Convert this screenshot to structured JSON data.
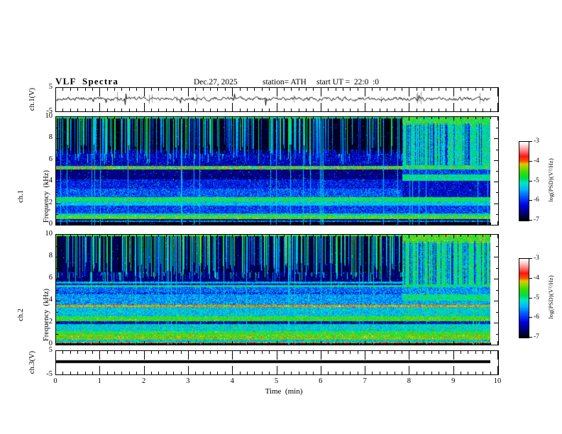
{
  "title": "VLF  Spectra",
  "header": {
    "date": "Dec.27, 2025",
    "station": "station= ATH",
    "start": "start UT =  22:0  :0"
  },
  "axes": {
    "time_label": "Time  (min)",
    "x_ticks": [
      "0",
      "1",
      "2",
      "3",
      "4",
      "5",
      "6",
      "7",
      "8",
      "9",
      "10"
    ],
    "freq_ticks": [
      "10",
      "8",
      "6",
      "4",
      "2",
      "0"
    ],
    "volt_ticks": [
      "5",
      "-5"
    ],
    "wave1_label": "ch.1(V)",
    "spec1_label": [
      "ch.1",
      "Frequency  (kHz)"
    ],
    "spec2_label": [
      "ch.2",
      "Frequency  (kHz)"
    ],
    "wave3_label": "ch.3(V)"
  },
  "colorbar": {
    "label": "log(PSD)(V²/Hz)",
    "ticks": [
      "-3",
      "-4",
      "-5",
      "-6",
      "-7"
    ],
    "range": [
      -7,
      -3
    ],
    "stops": [
      [
        0.0,
        "#000000"
      ],
      [
        0.08,
        "#000060"
      ],
      [
        0.2,
        "#0000e0"
      ],
      [
        0.3,
        "#0050ff"
      ],
      [
        0.4,
        "#00b4ff"
      ],
      [
        0.48,
        "#00e6c8"
      ],
      [
        0.54,
        "#00dc46"
      ],
      [
        0.62,
        "#3cdc00"
      ],
      [
        0.68,
        "#96d700"
      ],
      [
        0.72,
        "#e1c800"
      ],
      [
        0.76,
        "#ff5000"
      ],
      [
        0.82,
        "#ff1414"
      ],
      [
        0.9,
        "#ff8c8c"
      ],
      [
        0.96,
        "#ffd7d7"
      ],
      [
        1.0,
        "#ffffff"
      ]
    ]
  },
  "chart_data": {
    "type": "heatmap",
    "title": "VLF Spectra",
    "x": {
      "label": "Time (min)",
      "range": [
        0,
        10
      ],
      "data_end_min": 9.83,
      "major_tick_step": 1,
      "minor_per_major": 6
    },
    "psd_range_log": [
      -7,
      -3
    ],
    "panels": [
      {
        "id": "wave1",
        "kind": "waveform",
        "ylabel": "ch.1(V)",
        "ylim": [
          -5,
          5
        ],
        "yticks": [
          5,
          -5
        ],
        "baseline": 0.3,
        "noise_amp": 0.55,
        "spike_prob": 0.018,
        "spike_amp": 2.2,
        "gray_spike_prob": 0.012
      },
      {
        "id": "spec1",
        "kind": "spectrogram",
        "ylabel": "ch.1 Frequency (kHz)",
        "ylim": [
          0,
          10
        ],
        "yticks": [
          10,
          8,
          6,
          4,
          2,
          0
        ],
        "transition_min": 7.83,
        "bands_pre": [
          [
            0.0,
            0.28,
            -6.95,
            0.15
          ],
          [
            0.28,
            0.4,
            -5.6,
            0.6
          ],
          [
            0.4,
            0.55,
            -6.6,
            0.4
          ],
          [
            0.55,
            0.85,
            -4.6,
            0.55
          ],
          [
            0.85,
            1.08,
            -5.1,
            0.4
          ],
          [
            1.08,
            1.8,
            -5.9,
            0.45
          ],
          [
            1.8,
            2.15,
            -5.3,
            0.35
          ],
          [
            2.15,
            2.55,
            -4.85,
            0.35
          ],
          [
            2.55,
            3.35,
            -5.8,
            0.45
          ],
          [
            3.35,
            4.2,
            -6.1,
            0.45
          ],
          [
            4.2,
            5.1,
            -6.55,
            0.35
          ],
          [
            5.1,
            5.45,
            -4.6,
            0.8
          ],
          [
            5.45,
            7.0,
            -6.3,
            0.45
          ],
          [
            7.0,
            9.9,
            -6.9,
            0.25
          ],
          [
            9.9,
            10.01,
            -5.0,
            0.5
          ]
        ],
        "bands_post": [
          [
            0.0,
            0.28,
            -6.95,
            0.15
          ],
          [
            0.28,
            0.4,
            -5.6,
            0.6
          ],
          [
            0.4,
            0.55,
            -6.6,
            0.4
          ],
          [
            0.55,
            0.85,
            -4.6,
            0.55
          ],
          [
            0.85,
            1.08,
            -5.1,
            0.4
          ],
          [
            1.08,
            1.8,
            -5.9,
            0.45
          ],
          [
            1.8,
            2.15,
            -5.3,
            0.35
          ],
          [
            2.15,
            2.55,
            -4.85,
            0.35
          ],
          [
            2.55,
            4.1,
            -6.25,
            0.4
          ],
          [
            4.1,
            4.65,
            -5.0,
            0.3
          ],
          [
            4.65,
            5.1,
            -5.9,
            0.4
          ],
          [
            5.1,
            5.45,
            -4.8,
            0.6
          ],
          [
            5.45,
            9.3,
            -5.05,
            0.45
          ],
          [
            9.3,
            10.01,
            -4.7,
            0.5
          ]
        ],
        "streaks": {
          "prob": 0.5,
          "level": [
            -5.6,
            -4.3
          ],
          "fmin": [
            5.5,
            7.5
          ],
          "dark_prob": 0.3,
          "line_prob": 0.03
        }
      },
      {
        "id": "spec2",
        "kind": "spectrogram",
        "ylabel": "ch.2 Frequency (kHz)",
        "ylim": [
          0,
          10
        ],
        "yticks": [
          10,
          8,
          6,
          4,
          2,
          0
        ],
        "transition_min": 7.83,
        "bands_pre": [
          [
            0.0,
            0.15,
            -6.95,
            0.1
          ],
          [
            0.15,
            0.28,
            -4.3,
            0.9
          ],
          [
            0.28,
            0.45,
            -5.3,
            0.4
          ],
          [
            0.45,
            0.9,
            -4.45,
            0.5
          ],
          [
            0.9,
            1.2,
            -4.7,
            0.45
          ],
          [
            1.2,
            1.85,
            -5.2,
            0.4
          ],
          [
            1.85,
            2.1,
            -6.3,
            0.6
          ],
          [
            2.1,
            2.6,
            -4.65,
            0.4
          ],
          [
            2.6,
            3.42,
            -5.3,
            0.4
          ],
          [
            3.42,
            3.6,
            -4.1,
            0.3
          ],
          [
            3.6,
            4.6,
            -5.5,
            0.45
          ],
          [
            4.6,
            4.75,
            -5.9,
            0.7
          ],
          [
            4.75,
            5.2,
            -5.7,
            0.45
          ],
          [
            5.2,
            5.45,
            -5.0,
            0.5
          ],
          [
            5.45,
            5.55,
            -6.3,
            0.5
          ],
          [
            5.55,
            5.75,
            -5.4,
            0.4
          ],
          [
            5.75,
            9.9,
            -6.6,
            0.35
          ],
          [
            9.9,
            10.01,
            -4.8,
            0.7
          ]
        ],
        "bands_post": [
          [
            0.0,
            0.15,
            -6.95,
            0.1
          ],
          [
            0.15,
            0.28,
            -4.3,
            0.9
          ],
          [
            0.28,
            0.45,
            -5.3,
            0.4
          ],
          [
            0.45,
            0.9,
            -4.45,
            0.5
          ],
          [
            0.9,
            1.2,
            -4.7,
            0.45
          ],
          [
            1.2,
            1.85,
            -5.15,
            0.4
          ],
          [
            1.85,
            2.1,
            -6.2,
            0.6
          ],
          [
            2.1,
            2.6,
            -4.6,
            0.4
          ],
          [
            2.6,
            3.42,
            -5.2,
            0.4
          ],
          [
            3.42,
            3.6,
            -4.1,
            0.3
          ],
          [
            3.6,
            4.0,
            -5.4,
            0.4
          ],
          [
            4.0,
            4.6,
            -4.95,
            0.35
          ],
          [
            4.6,
            5.2,
            -5.5,
            0.45
          ],
          [
            5.2,
            5.45,
            -5.0,
            0.5
          ],
          [
            5.45,
            9.2,
            -4.95,
            0.45
          ],
          [
            9.2,
            10.01,
            -4.55,
            0.5
          ]
        ],
        "streaks": {
          "prob": 0.6,
          "level": [
            -5.4,
            -4.1
          ],
          "fmin": [
            5.6,
            7.5
          ],
          "dark_prob": 0.33,
          "line_prob": 0.04
        }
      },
      {
        "id": "wave3",
        "kind": "flatline",
        "ylabel": "ch.3(V)",
        "ylim": [
          -5,
          5
        ],
        "yticks": [
          5,
          -5
        ],
        "value": 0.4,
        "thickness": 4
      }
    ]
  }
}
